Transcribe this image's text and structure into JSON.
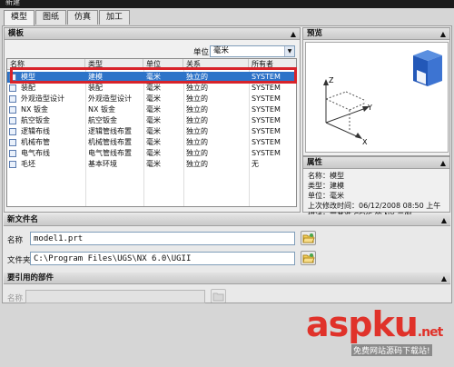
{
  "window": {
    "title": "新建"
  },
  "tabs": [
    {
      "label": "模型",
      "active": true
    },
    {
      "label": "图纸",
      "active": false
    },
    {
      "label": "仿真",
      "active": false
    },
    {
      "label": "加工",
      "active": false
    }
  ],
  "templates": {
    "section_title": "模板",
    "unit_label": "单位",
    "unit_value": "毫米",
    "columns": [
      "名称",
      "类型",
      "单位",
      "关系",
      "所有者"
    ],
    "rows": [
      {
        "name": "模型",
        "type": "建模",
        "unit": "毫米",
        "relation": "独立的",
        "owner": "SYSTEM",
        "selected": true
      },
      {
        "name": "装配",
        "type": "装配",
        "unit": "毫米",
        "relation": "独立的",
        "owner": "SYSTEM",
        "selected": false
      },
      {
        "name": "外观造型设计",
        "type": "外观造型设计",
        "unit": "毫米",
        "relation": "独立的",
        "owner": "SYSTEM",
        "selected": false
      },
      {
        "name": "NX 钣金",
        "type": "NX 钣金",
        "unit": "毫米",
        "relation": "独立的",
        "owner": "SYSTEM",
        "selected": false
      },
      {
        "name": "航空钣金",
        "type": "航空钣金",
        "unit": "毫米",
        "relation": "独立的",
        "owner": "SYSTEM",
        "selected": false
      },
      {
        "name": "逻辑布线",
        "type": "逻辑管线布置",
        "unit": "毫米",
        "relation": "独立的",
        "owner": "SYSTEM",
        "selected": false
      },
      {
        "name": "机械布管",
        "type": "机械管线布置",
        "unit": "毫米",
        "relation": "独立的",
        "owner": "SYSTEM",
        "selected": false
      },
      {
        "name": "电气布线",
        "type": "电气管线布置",
        "unit": "毫米",
        "relation": "独立的",
        "owner": "SYSTEM",
        "selected": false
      },
      {
        "name": "毛坯",
        "type": "基本环境",
        "unit": "毫米",
        "relation": "独立的",
        "owner": "无",
        "selected": false
      }
    ]
  },
  "preview": {
    "section_title": "预览",
    "axis_labels": [
      "Z",
      "Y",
      "X"
    ]
  },
  "properties": {
    "section_title": "属性",
    "rows": [
      {
        "label": "名称：",
        "value": "模型"
      },
      {
        "label": "类型：",
        "value": "建模"
      },
      {
        "label": "单位：",
        "value": "毫米"
      },
      {
        "label": "上次修改时间：",
        "value": "06/12/2008 08:50 上午"
      },
      {
        "label": "描述：",
        "value": "带基准 CSYS 的 NX 示例"
      }
    ]
  },
  "new_file": {
    "section_title": "新文件名",
    "name_label": "名称",
    "name_value": "model1.prt",
    "folder_label": "文件夹",
    "folder_value": "C:\\Program Files\\UGS\\NX 6.0\\UGII"
  },
  "referenced_parts": {
    "section_title": "要引用的部件",
    "name_label": "名称",
    "name_value": ""
  },
  "watermark": {
    "text": "aspku",
    "suffix": ".net",
    "subtext": "免费网站源码下载站!"
  }
}
